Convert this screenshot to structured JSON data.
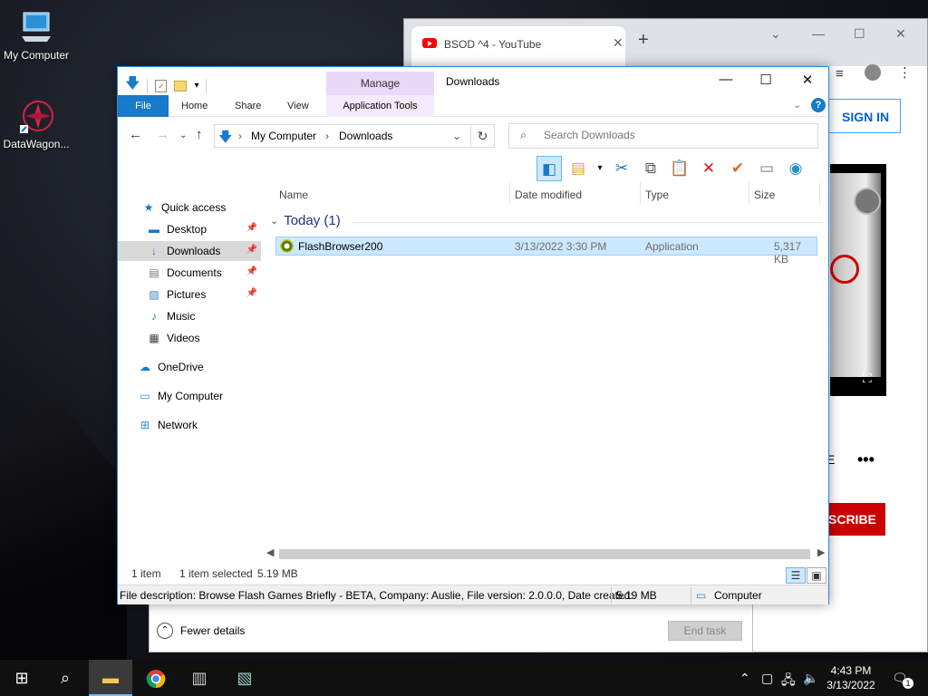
{
  "desktop": {
    "icons": [
      {
        "label": "My Computer"
      },
      {
        "label": "DataWagon..."
      }
    ]
  },
  "chrome": {
    "tab_title": "BSOD ^4 - YouTube",
    "sign_in": "SIGN IN",
    "subscribe": "SCRIBE",
    "partial_label": "E",
    "more": "•••"
  },
  "taskmgr": {
    "fewer_details": "Fewer details",
    "end_task": "End task"
  },
  "explorer": {
    "manage": "Manage",
    "title": "Downloads",
    "ribbon": {
      "file": "File",
      "home": "Home",
      "share": "Share",
      "view": "View",
      "app_tools": "Application Tools"
    },
    "address": {
      "root": "My Computer",
      "current": "Downloads"
    },
    "search_placeholder": "Search Downloads",
    "nav": [
      {
        "label": "Quick access"
      },
      {
        "label": "Desktop"
      },
      {
        "label": "Downloads"
      },
      {
        "label": "Documents"
      },
      {
        "label": "Pictures"
      },
      {
        "label": "Music"
      },
      {
        "label": "Videos"
      },
      {
        "label": "OneDrive"
      },
      {
        "label": "My Computer"
      },
      {
        "label": "Network"
      }
    ],
    "columns": {
      "name": "Name",
      "date": "Date modified",
      "type": "Type",
      "size": "Size"
    },
    "group": "Today (1)",
    "file": {
      "name": "FlashBrowser200",
      "date": "3/13/2022 3:30 PM",
      "type": "Application",
      "size": "5,317 KB"
    },
    "status": {
      "count": "1 item",
      "selected": "1 item selected",
      "size": "5.19 MB"
    },
    "info": {
      "description": "File description: Browse Flash Games Briefly - BETA, Company: Auslie, File version: 2.0.0.0, Date created:",
      "size": "5.19 MB",
      "location": "Computer"
    }
  },
  "taskbar": {
    "time": "4:43 PM",
    "date": "3/13/2022",
    "notification_count": "1"
  },
  "colors": {
    "accent": "#1979ca",
    "selection": "#cce8ff",
    "manage": "#e9d8f8"
  }
}
